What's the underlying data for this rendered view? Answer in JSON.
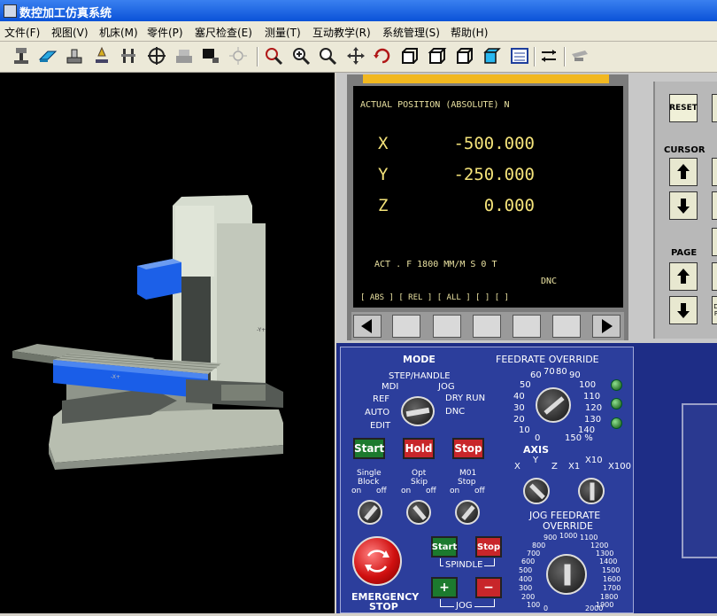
{
  "window": {
    "title": "数控加工仿真系统"
  },
  "menu": [
    "文件(F)",
    "视图(V)",
    "机床(M)",
    "零件(P)",
    "塞尺检查(E)",
    "测量(T)",
    "互动教学(R)",
    "系统管理(S)",
    "帮助(H)"
  ],
  "toolbar_icons": [
    "origin-icon",
    "eraser-icon",
    "fixture-icon",
    "tool-icon",
    "caliper-icon",
    "target-icon",
    "workpiece-icon",
    "monitor-icon",
    "light-icon",
    "zoom-box-icon",
    "zoom-in-icon",
    "zoom-out-icon",
    "pan-icon",
    "rotate-icon",
    "view-left-icon",
    "view-iso-icon",
    "view-front-icon",
    "view-top-icon",
    "list-icon",
    "swap-icon",
    "gray-tool-icon"
  ],
  "display": {
    "header": "ACTUAL  POSITION (ABSOLUTE)    N",
    "axes": [
      {
        "name": "X",
        "value": "-500.000"
      },
      {
        "name": "Y",
        "value": "-250.000"
      },
      {
        "name": "Z",
        "value": "0.000"
      }
    ],
    "status": "ACT . F 1800  MM/M      S  0    T",
    "mode": "DNC",
    "softkeys": "[ ABS ]  [ REL ]  [ ALL ]  [     ]  [     ]"
  },
  "keys": {
    "reset": "RESET",
    "cursor": "CURSOR",
    "page": "PAGE",
    "d_key": "D",
    "p_key": "P"
  },
  "mode": {
    "title": "MODE",
    "options": {
      "step_handle": "STEP/HANDLE",
      "mdi": "MDI",
      "jog": "JOG",
      "ref": "REF",
      "dry_run": "DRY RUN",
      "auto": "AUTO",
      "dnc": "DNC",
      "edit": "EDIT"
    }
  },
  "feedrate": {
    "title": "FEEDRATE OVERRIDE",
    "labels": {
      "l60": "60",
      "l70": "70",
      "l80": "80",
      "l90": "90",
      "l50": "50",
      "l100": "100",
      "l40": "40",
      "l110": "110",
      "l30": "30",
      "l120": "120",
      "l20": "20",
      "l130": "130",
      "l10": "10",
      "l140": "140",
      "l0": "0",
      "l150": "150 %"
    }
  },
  "buttons": {
    "start": "Start",
    "hold": "Hold",
    "stop": "Stop"
  },
  "switches": [
    {
      "name": "Single Block",
      "line1": "Single",
      "line2": "Block",
      "on": "on",
      "off": "off"
    },
    {
      "name": "Opt Skip",
      "line1": "Opt",
      "line2": "Skip",
      "on": "on",
      "off": "off"
    },
    {
      "name": "M01 Stop",
      "line1": "M01",
      "line2": "Stop",
      "on": "on",
      "off": "off"
    }
  ],
  "axis_sel": {
    "title": "AXIS",
    "x": "X",
    "y": "Y",
    "z": "Z",
    "x1": "X1",
    "x10": "X10",
    "x100": "X100"
  },
  "emergency": {
    "line1": "EMERGENCY",
    "line2": "STOP"
  },
  "spindle": {
    "start": "Start",
    "stop": "Stop",
    "label": "SPINDLE"
  },
  "jog": {
    "plus": "+",
    "minus": "−",
    "label": "JOG"
  },
  "jog_feed": {
    "title1": "JOG FEEDRATE",
    "title2": "OVERRIDE",
    "labels": {
      "l900": "900",
      "l1000": "1000",
      "l1100": "1100",
      "l800": "800",
      "l1200": "1200",
      "l700": "700",
      "l1300": "1300",
      "l600": "600",
      "l1400": "1400",
      "l500": "500",
      "l1500": "1500",
      "l400": "400",
      "l1600": "1600",
      "l300": "300",
      "l1700": "1700",
      "l200": "200",
      "l1800": "1800",
      "l100": "100",
      "l1900": "1900",
      "l0": "0",
      "l2000": "2000"
    }
  },
  "colors": {
    "panel": "#2c3e9c",
    "start_green": "#1c7a2e",
    "hold_red": "#c8262a",
    "crt_text": "#f4e37a",
    "machine_blue": "#1a5ee8"
  }
}
